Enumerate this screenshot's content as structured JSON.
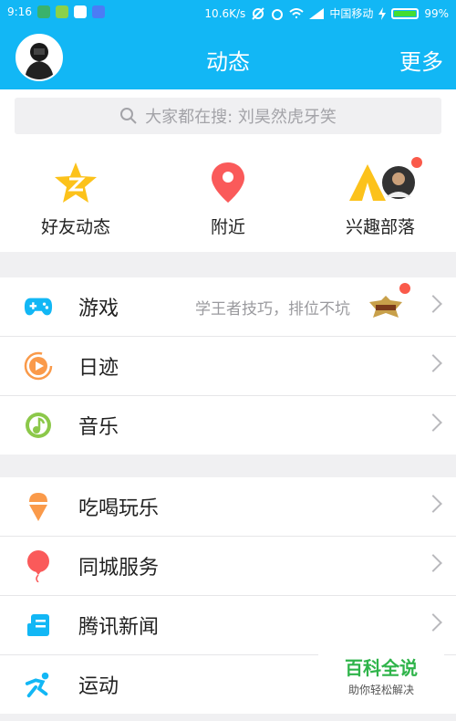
{
  "status_bar": {
    "time": "9:16",
    "speed": "10.6K/s",
    "carrier": "中国移动",
    "battery": "99%"
  },
  "header": {
    "title": "动态",
    "more": "更多"
  },
  "search": {
    "placeholder": "大家都在搜: 刘昊然虎牙笑"
  },
  "quick_links": [
    {
      "label": "好友动态",
      "icon": "qzone-star-icon"
    },
    {
      "label": "附近",
      "icon": "location-pin-icon"
    },
    {
      "label": "兴趣部落",
      "icon": "tribe-icon"
    }
  ],
  "section1": [
    {
      "label": "游戏",
      "sub": "学王者技巧，排位不坑",
      "icon": "gamepad-icon"
    },
    {
      "label": "日迹",
      "icon": "daily-track-icon"
    },
    {
      "label": "音乐",
      "icon": "music-icon"
    }
  ],
  "section2": [
    {
      "label": "吃喝玩乐",
      "icon": "icecream-icon"
    },
    {
      "label": "同城服务",
      "icon": "balloon-icon"
    },
    {
      "label": "腾讯新闻",
      "icon": "news-icon"
    },
    {
      "label": "运动",
      "icon": "run-icon"
    }
  ],
  "watermark": {
    "title": "百科全说",
    "subtitle": "助你轻松解决"
  },
  "colors": {
    "header": "#12b7f5",
    "badge": "#fa5a4a"
  }
}
